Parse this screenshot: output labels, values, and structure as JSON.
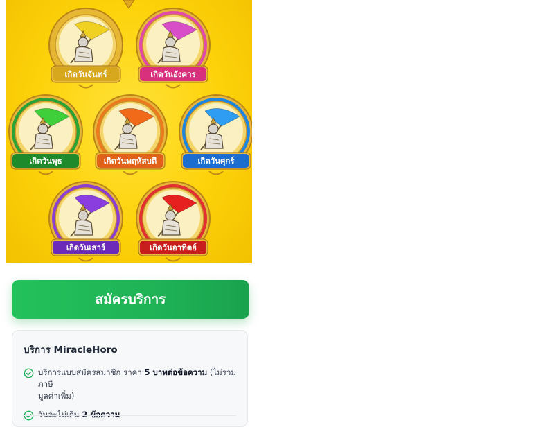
{
  "banner": {
    "days": [
      {
        "label": "เกิดวันจันทร์",
        "flag": "#f0d020",
        "ring": "#e6b830",
        "ribbon": "#d7a81e"
      },
      {
        "label": "เกิดวันอังคาร",
        "flag": "#d84ec8",
        "ring": "#e04aa8",
        "ribbon": "#d8307f"
      },
      {
        "label": "เกิดวันพุธ",
        "flag": "#3fcf3a",
        "ring": "#2aa236",
        "ribbon": "#1f8a2c"
      },
      {
        "label": "เกิดวันพฤหัสบดี",
        "flag": "#f06a1a",
        "ring": "#ec7a1e",
        "ribbon": "#e0621a"
      },
      {
        "label": "เกิดวันศุกร์",
        "flag": "#2f9df2",
        "ring": "#1f86e0",
        "ribbon": "#1b6dd0"
      },
      {
        "label": "เกิดวันเสาร์",
        "flag": "#8a3ee0",
        "ring": "#8a3fd0",
        "ribbon": "#6b2bb8"
      },
      {
        "label": "เกิดวันอาทิตย์",
        "flag": "#e61f1f",
        "ring": "#e03030",
        "ribbon": "#c81e1e"
      }
    ]
  },
  "cta": {
    "label": "สมัครบริการ"
  },
  "service": {
    "title_prefix": "บริการ ",
    "title_name": "MiracleHoro",
    "features": [
      {
        "text_a": "บริการแบบสมัครสมาชิก ราคา ",
        "bold": "5 บาทต่อข้อความ",
        "text_b": " (ไม่รวมภาษี",
        "line2": "มูลค่าเพิ่ม)"
      },
      {
        "text_a": "วันละไม่เกิน ",
        "bold": "2 ข้อความ",
        "text_b": "",
        "line2": ""
      }
    ]
  }
}
